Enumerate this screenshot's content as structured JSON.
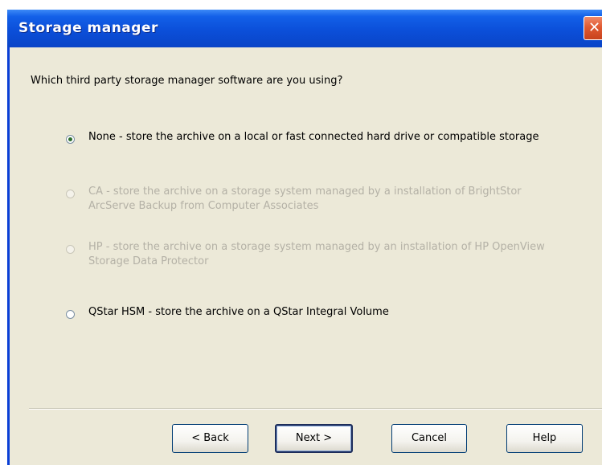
{
  "window": {
    "title": "Storage manager",
    "close_symbol": "✕"
  },
  "question": "Which third party storage manager software are you using?",
  "options": [
    {
      "label": "None - store the archive on a local or fast connected hard drive or compatible storage",
      "selected": true,
      "enabled": true
    },
    {
      "label": "CA - store the archive on a storage system managed by a installation of BrightStor ArcServe Backup from Computer Associates",
      "selected": false,
      "enabled": false
    },
    {
      "label": "HP - store the archive on a storage system managed by an installation of HP OpenView Storage Data Protector",
      "selected": false,
      "enabled": false
    },
    {
      "label": "QStar HSM - store the archive on a QStar Integral Volume",
      "selected": false,
      "enabled": true
    }
  ],
  "buttons": {
    "back": "< Back",
    "next": "Next >",
    "cancel": "Cancel",
    "help": "Help"
  }
}
